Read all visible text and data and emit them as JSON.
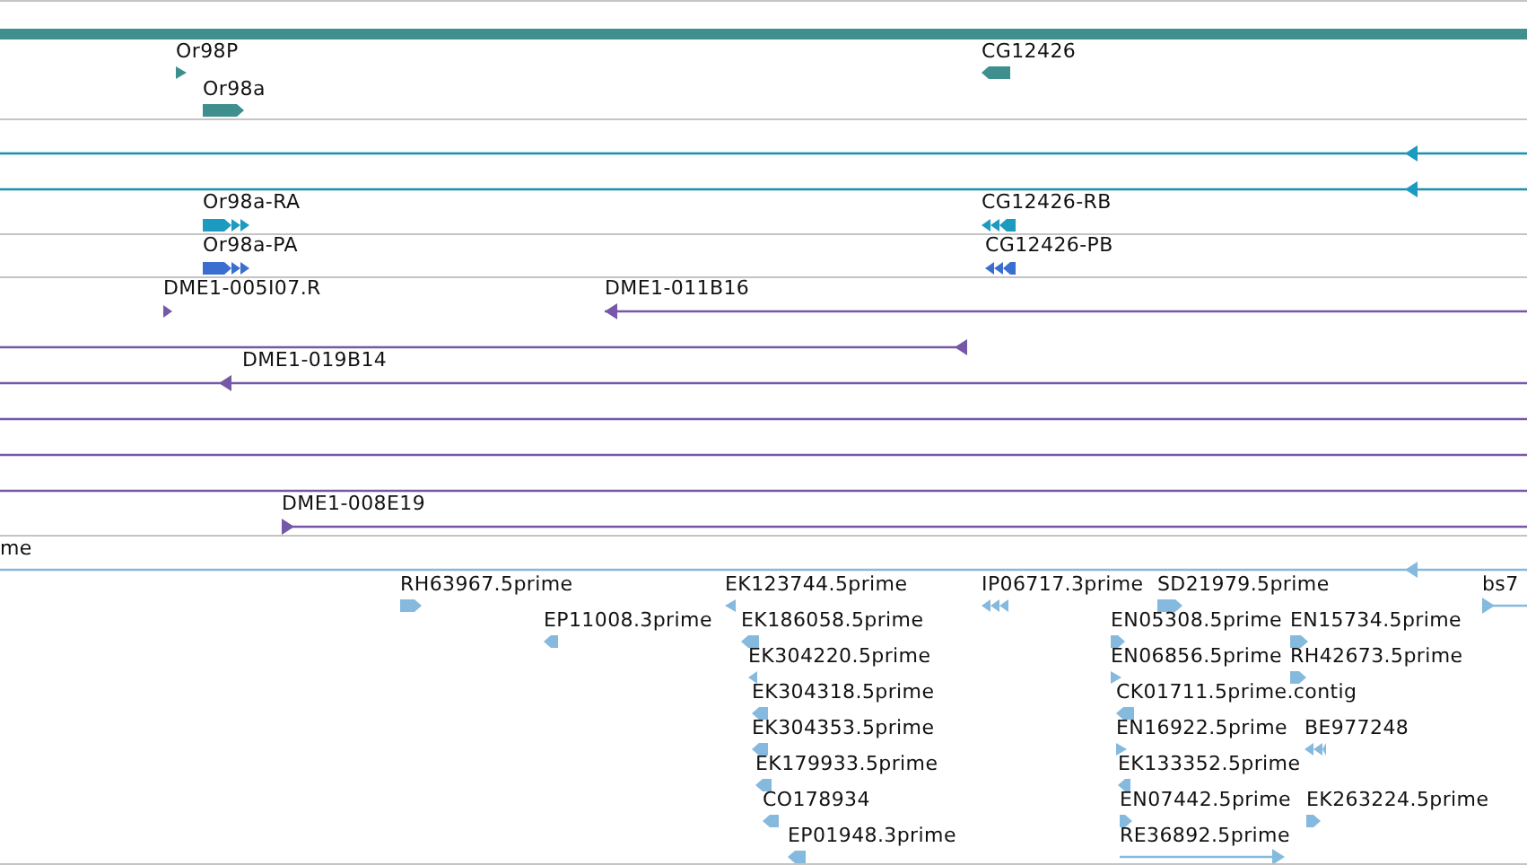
{
  "tracks": [
    {
      "kind": "gene",
      "features": [
        {
          "kind": "bar"
        },
        {
          "kind": "arrow",
          "reverse": false,
          "label": "Or98P"
        },
        {
          "kind": "arrow",
          "reverse": true,
          "label": "CG12426"
        },
        {
          "kind": "arrow",
          "reverse": false,
          "label": "Or98a"
        }
      ]
    },
    {
      "kind": "rna",
      "features": [
        {
          "kind": "line",
          "reverse": true
        },
        {
          "kind": "line",
          "reverse": true
        },
        {
          "kind": "segmented",
          "reverse": false,
          "label": "Or98a-RA"
        },
        {
          "kind": "segmented",
          "reverse": true,
          "label": "CG12426-RB"
        }
      ]
    },
    {
      "kind": "protein",
      "features": [
        {
          "kind": "segmented",
          "reverse": false,
          "label": "Or98a-PA"
        },
        {
          "kind": "segmented",
          "reverse": true,
          "label": "CG12426-PB"
        }
      ]
    },
    {
      "kind": "clone",
      "features": [
        {
          "kind": "arrow",
          "reverse": false,
          "label": "DME1-005I07.R"
        },
        {
          "kind": "line",
          "reverse": true,
          "label": "DME1-011B16"
        },
        {
          "kind": "line",
          "reverse": true
        },
        {
          "kind": "line",
          "reverse": true,
          "label": "DME1-019B14"
        },
        {
          "kind": "line"
        },
        {
          "kind": "line"
        },
        {
          "kind": "line"
        },
        {
          "kind": "line",
          "reverse": false,
          "label": "DME1-008E19"
        }
      ]
    },
    {
      "kind": "est",
      "features": [
        {
          "label": "me"
        },
        {
          "kind": "line",
          "reverse": true
        },
        {
          "kind": "arrow",
          "reverse": false,
          "label": "RH63967.5prime"
        },
        {
          "kind": "arrow",
          "reverse": true,
          "label": "EK123744.5prime"
        },
        {
          "kind": "segmented",
          "reverse": true,
          "label": "IP06717.3prime"
        },
        {
          "kind": "arrow",
          "reverse": false,
          "label": "SD21979.5prime"
        },
        {
          "kind": "line",
          "reverse": false,
          "label": "bs7"
        },
        {
          "kind": "arrow",
          "reverse": true,
          "label": "EP11008.3prime"
        },
        {
          "kind": "arrow",
          "reverse": true,
          "label": "EK186058.5prime"
        },
        {
          "kind": "arrow",
          "reverse": false,
          "label": "EN05308.5prime"
        },
        {
          "kind": "arrow",
          "reverse": false,
          "label": "EN15734.5prime"
        },
        {
          "kind": "arrow",
          "reverse": true,
          "label": "EK304220.5prime"
        },
        {
          "kind": "arrow",
          "reverse": false,
          "label": "EN06856.5prime"
        },
        {
          "kind": "arrow",
          "reverse": false,
          "label": "RH42673.5prime"
        },
        {
          "kind": "arrow",
          "reverse": true,
          "label": "EK304318.5prime"
        },
        {
          "kind": "arrow",
          "reverse": true,
          "label": "CK01711.5prime.contig"
        },
        {
          "kind": "arrow",
          "reverse": true,
          "label": "EK304353.5prime"
        },
        {
          "kind": "arrow",
          "reverse": false,
          "label": "EN16922.5prime"
        },
        {
          "kind": "segmented",
          "reverse": true,
          "label": "BE977248"
        },
        {
          "kind": "arrow",
          "reverse": true,
          "label": "EK179933.5prime"
        },
        {
          "kind": "arrow",
          "reverse": true,
          "label": "EK133352.5prime"
        },
        {
          "kind": "arrow",
          "reverse": true,
          "label": "CO178934"
        },
        {
          "kind": "arrow",
          "reverse": false,
          "label": "EN07442.5prime"
        },
        {
          "kind": "arrow",
          "reverse": false,
          "label": "EK263224.5prime"
        },
        {
          "kind": "arrow",
          "reverse": true,
          "label": "EP01948.3prime"
        },
        {
          "kind": "line",
          "reverse": false,
          "label": "RE36892.5prime"
        }
      ]
    }
  ]
}
